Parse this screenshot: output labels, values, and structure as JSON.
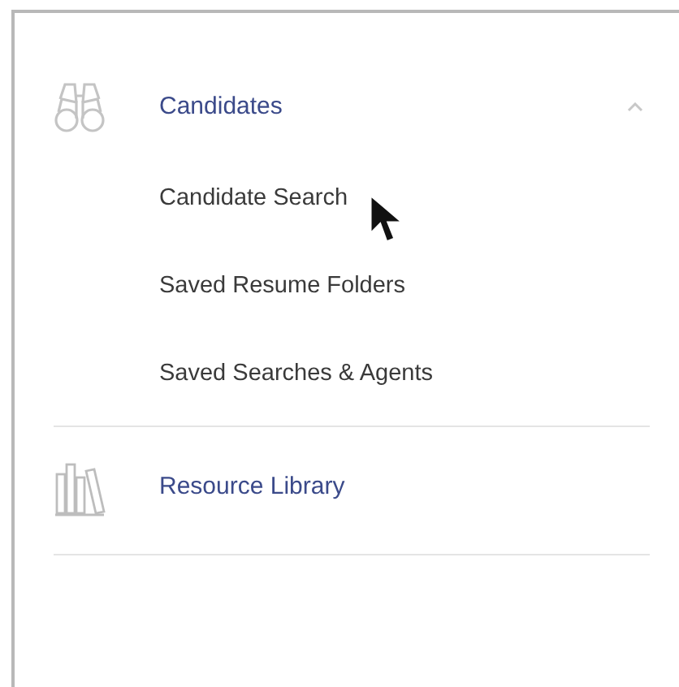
{
  "sections": [
    {
      "kind": "binoculars",
      "label": "Candidates",
      "expanded": true,
      "items": [
        "Candidate Search",
        "Saved Resume Folders",
        "Saved Searches & Agents"
      ]
    },
    {
      "kind": "books",
      "label": "Resource Library"
    }
  ]
}
